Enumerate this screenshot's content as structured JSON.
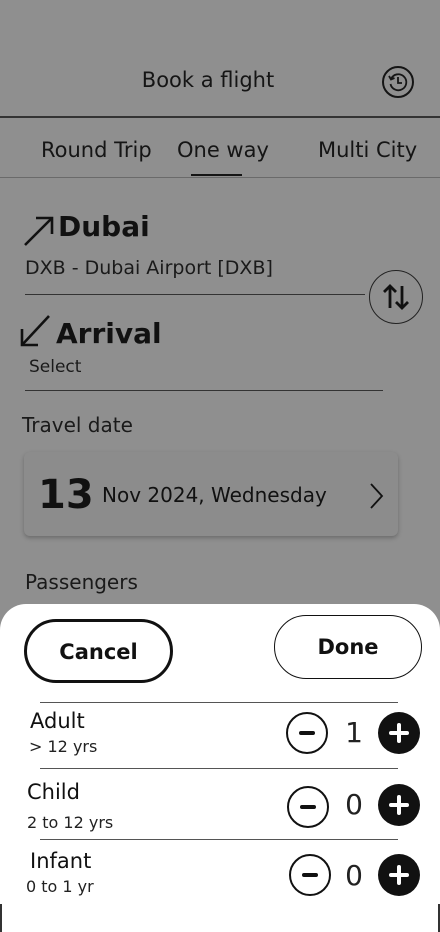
{
  "header": {
    "title": "Book a flight",
    "history_icon": "history-icon"
  },
  "tabs": [
    {
      "label": "Round Trip",
      "active": false
    },
    {
      "label": "One way",
      "active": true
    },
    {
      "label": "Multi City",
      "active": false
    }
  ],
  "departure": {
    "city": "Dubai",
    "airport": "DXB - Dubai Airport [DXB]",
    "icon": "arrow-up-right-icon"
  },
  "arrival": {
    "title": "Arrival",
    "placeholder": "Select",
    "icon": "arrow-down-left-icon"
  },
  "swap_icon": "swap-vertical-icon",
  "travel_date": {
    "label": "Travel date",
    "day": "13",
    "month_year": "Nov 2024,",
    "weekday": "Wednesday"
  },
  "passengers_label": "Passengers",
  "sheet": {
    "cancel_label": "Cancel",
    "done_label": "Done",
    "rows": [
      {
        "name": "Adult",
        "range": "> 12 yrs",
        "count": "1"
      },
      {
        "name": "Child",
        "range": "2 to 12 yrs",
        "count": "0"
      },
      {
        "name": "Infant",
        "range": "0 to 1 yr",
        "count": "0"
      }
    ]
  },
  "colors": {
    "overlay": "#8f8f8f",
    "sheet": "#ffffff",
    "ink": "#111111"
  }
}
